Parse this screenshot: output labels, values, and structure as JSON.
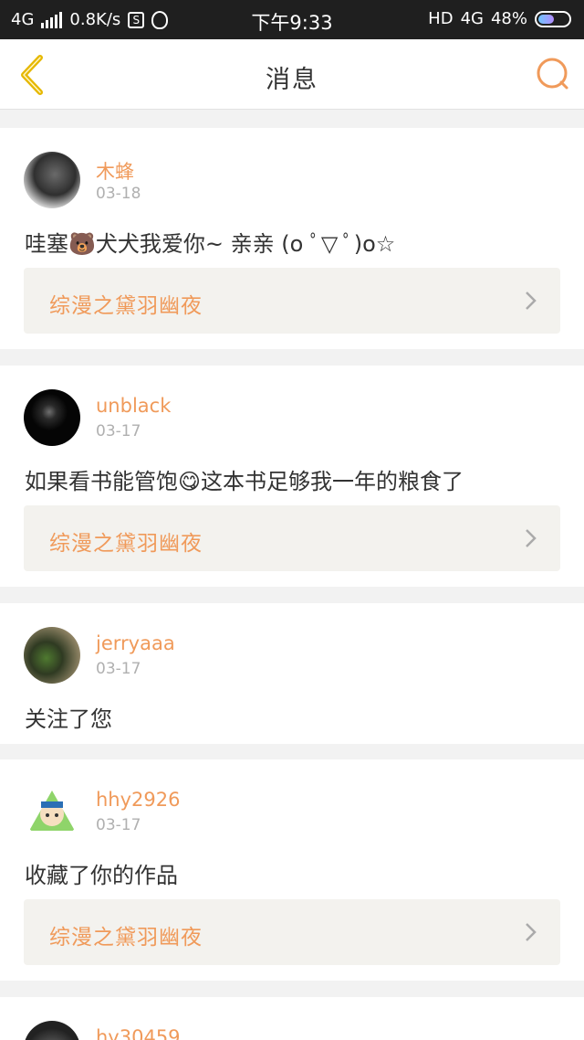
{
  "status_bar": {
    "network": "4G",
    "speed": "0.8K/s",
    "s_icon_letter": "S",
    "time": "下午9:33",
    "hd": "HD",
    "network_right": "4G",
    "battery": "48%"
  },
  "nav": {
    "title": "消息",
    "back_icon": "chevron-left-icon",
    "search_icon": "search-icon"
  },
  "colors": {
    "accent": "#f09a5a",
    "back_icon": "#e6b800",
    "background": "#f2f2f2",
    "book_bg": "#f3f2ee"
  },
  "messages": [
    {
      "username": "木蜂",
      "date": "03-18",
      "text": "哇塞🐻犬犬我爱你~ 亲亲 (o ﾟ▽ ﾟ)o☆",
      "book": "综漫之黛羽幽夜"
    },
    {
      "username": "unblack",
      "date": "03-17",
      "text": "如果看书能管饱😋这本书足够我一年的粮食了",
      "book": "综漫之黛羽幽夜"
    },
    {
      "username": "jerryaaa",
      "date": "03-17",
      "text": "关注了您"
    },
    {
      "username": "hhy2926",
      "date": "03-17",
      "text": "收藏了你的作品",
      "book": "综漫之黛羽幽夜"
    },
    {
      "username": "hy30459"
    }
  ]
}
